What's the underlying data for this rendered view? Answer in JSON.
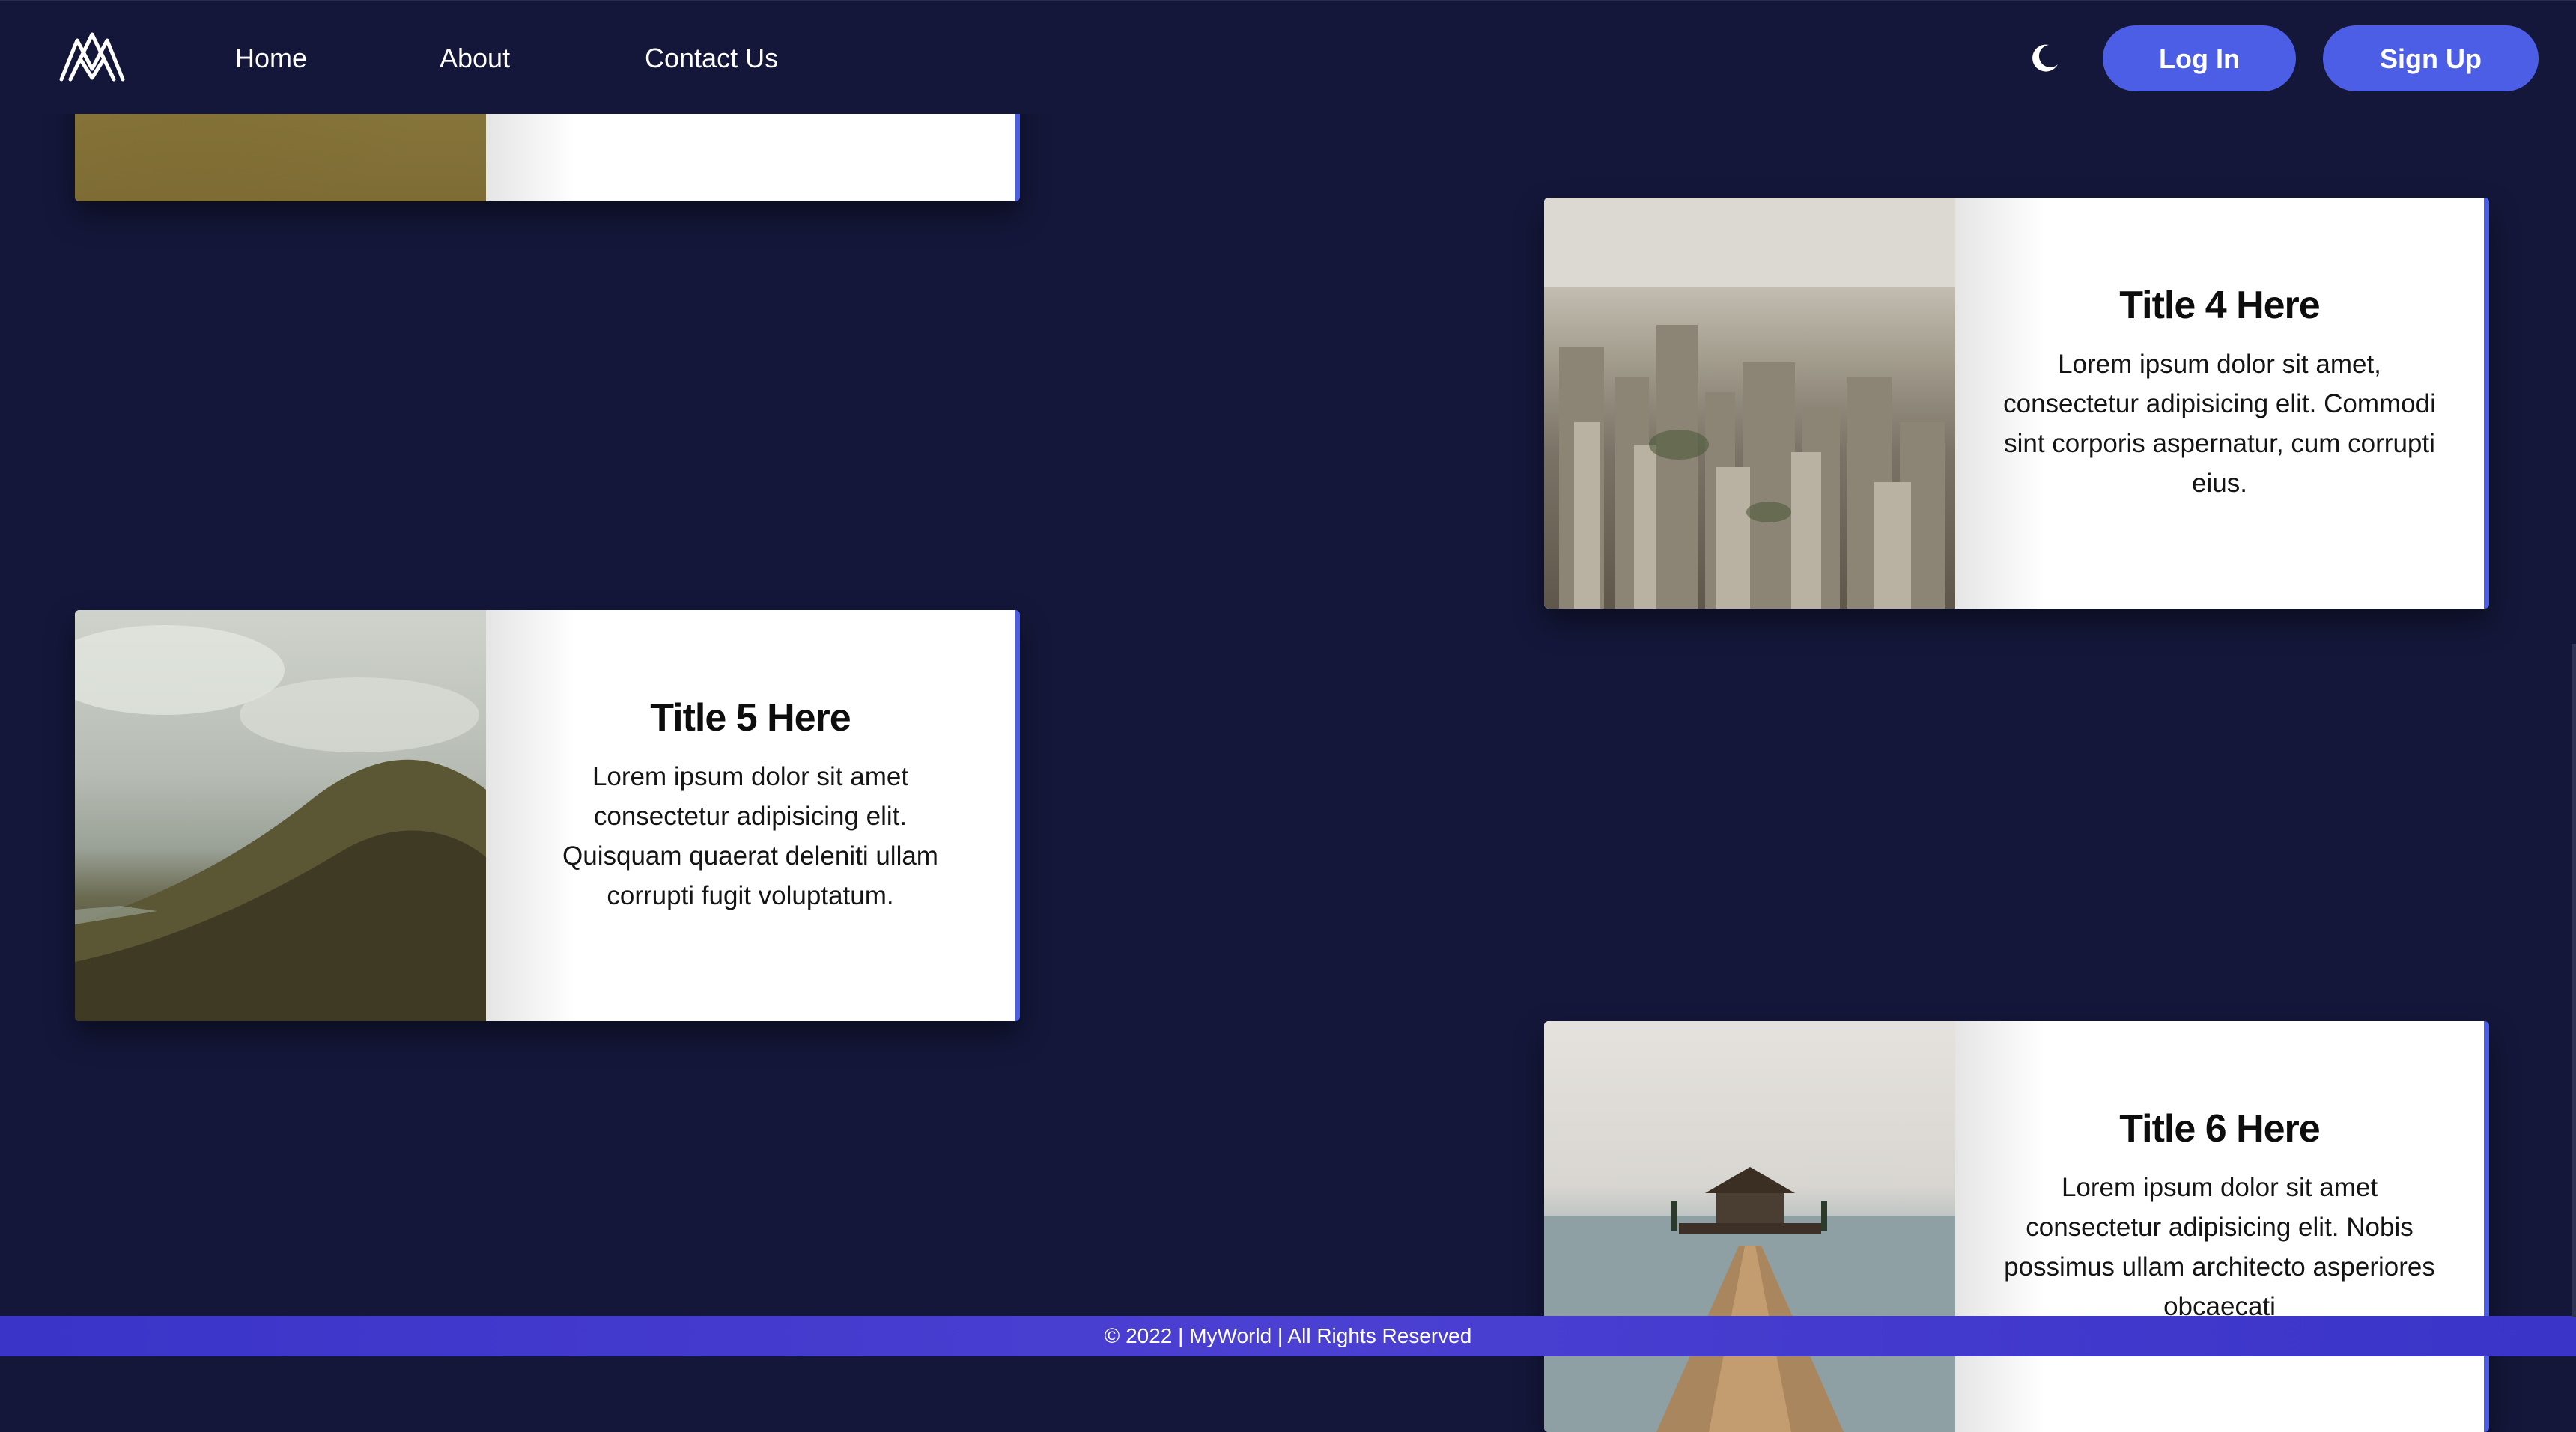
{
  "nav": {
    "logo_label": "",
    "links": {
      "home": "Home",
      "about": "About",
      "contact": "Contact Us"
    },
    "login_label": "Log In",
    "signup_label": "Sign Up",
    "theme_icon": "moon-icon"
  },
  "cards": {
    "card1": {
      "title": "",
      "text": "",
      "image": "wheat-field"
    },
    "card4": {
      "title": "Title 4 Here",
      "text": "Lorem ipsum dolor sit amet, consectetur adipisicing elit. Commodi sint corporis aspernatur, cum corrupti eius.",
      "image": "city-skyline"
    },
    "card5": {
      "title": "Title 5 Here",
      "text": "Lorem ipsum dolor sit amet consectetur adipisicing elit. Quisquam quaerat deleniti ullam corrupti fugit voluptatum.",
      "image": "green-hill"
    },
    "card6": {
      "title": "Title 6 Here",
      "text": "Lorem ipsum dolor sit amet consectetur adipisicing elit. Nobis possimus ullam architecto asperiores obcaecati",
      "image": "pier-gazebo"
    }
  },
  "footer": {
    "text": "© 2022 | MyWorld | All Rights Reserved"
  },
  "colors": {
    "background": "#14173a",
    "accent": "#4c5ee6",
    "footer": "#4b40d2"
  }
}
